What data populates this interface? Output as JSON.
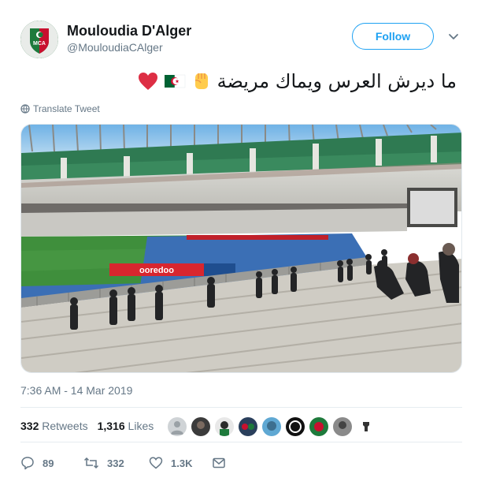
{
  "account": {
    "display_name": "Mouloudia D'Alger",
    "handle": "@MouloudiaCAlger",
    "avatar_text": "MCA",
    "follow_label": "Follow"
  },
  "tweet": {
    "text_arabic": "ما ديرش العرس ويماك مريضة",
    "emojis": [
      "raised-fist-emoji",
      "algeria-flag-emoji",
      "red-heart-emoji"
    ],
    "translate_label": "Translate Tweet",
    "timestamp": "7:36 AM - 14 Mar 2019"
  },
  "media": {
    "description_icon": "stadium-photo",
    "banner_text": "ooredoo"
  },
  "stats": {
    "retweets_count": "332",
    "retweets_label": "Retweets",
    "likes_count": "1,316",
    "likes_label": "Likes",
    "liker_avatars": 10
  },
  "actions": {
    "reply_count": "89",
    "retweet_count": "332",
    "like_count": "1.3K"
  },
  "colors": {
    "accent": "#1da1f2",
    "text_primary": "#14171a",
    "text_secondary": "#657786",
    "divider": "#e6ecf0"
  }
}
